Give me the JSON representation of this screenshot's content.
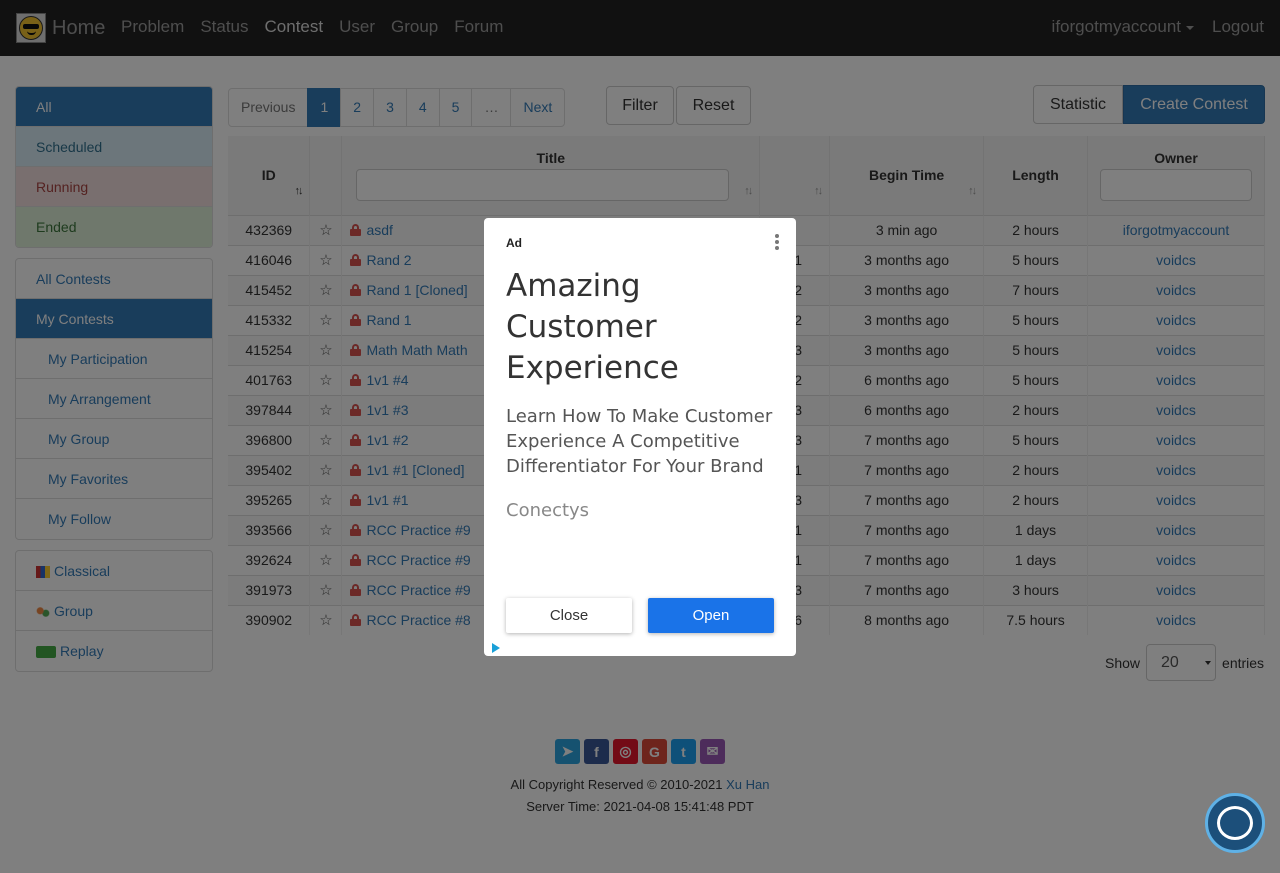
{
  "navbar": {
    "brand": "Home",
    "links": [
      "Problem",
      "Status",
      "Contest",
      "User",
      "Group",
      "Forum"
    ],
    "user": "iforgotmyaccount",
    "logout": "Logout"
  },
  "sidebar": {
    "status_filters": [
      "All",
      "Scheduled",
      "Running",
      "Ended"
    ],
    "contest_scope": [
      "All Contests",
      "My Contests"
    ],
    "my_items": [
      "My Participation",
      "My Arrangement",
      "My Group",
      "My Favorites",
      "My Follow"
    ],
    "categories": [
      "Classical",
      "Group",
      "Replay"
    ]
  },
  "pagination": [
    "Previous",
    "1",
    "2",
    "3",
    "4",
    "5",
    "…",
    "Next"
  ],
  "buttons": {
    "filter": "Filter",
    "reset": "Reset",
    "statistic": "Statistic",
    "create": "Create Contest"
  },
  "table": {
    "headers": {
      "id": "ID",
      "title": "Title",
      "begin": "Begin Time",
      "length": "Length",
      "owner": "Owner"
    },
    "rows": [
      {
        "id": "432369",
        "title": "asdf",
        "type": "",
        "begin": "3 min ago",
        "length": "2 hours",
        "owner": "iforgotmyaccount"
      },
      {
        "id": "416046",
        "title": "Rand 2",
        "type": "x1",
        "begin": "3 months ago",
        "length": "5 hours",
        "owner": "voidcs"
      },
      {
        "id": "415452",
        "title": "Rand 1 [Cloned]",
        "type": "x2",
        "begin": "3 months ago",
        "length": "7 hours",
        "owner": "voidcs"
      },
      {
        "id": "415332",
        "title": "Rand 1",
        "type": "x2",
        "begin": "3 months ago",
        "length": "5 hours",
        "owner": "voidcs"
      },
      {
        "id": "415254",
        "title": "Math Math Math",
        "type": "x3",
        "begin": "3 months ago",
        "length": "5 hours",
        "owner": "voidcs"
      },
      {
        "id": "401763",
        "title": "1v1 #4",
        "type": "x2",
        "begin": "6 months ago",
        "length": "5 hours",
        "owner": "voidcs"
      },
      {
        "id": "397844",
        "title": "1v1 #3",
        "type": "x3",
        "begin": "6 months ago",
        "length": "2 hours",
        "owner": "voidcs"
      },
      {
        "id": "396800",
        "title": "1v1 #2",
        "type": "x3",
        "begin": "7 months ago",
        "length": "5 hours",
        "owner": "voidcs"
      },
      {
        "id": "395402",
        "title": "1v1 #1 [Cloned]",
        "type": "x1",
        "begin": "7 months ago",
        "length": "2 hours",
        "owner": "voidcs"
      },
      {
        "id": "395265",
        "title": "1v1 #1",
        "type": "x3",
        "begin": "7 months ago",
        "length": "2 hours",
        "owner": "voidcs"
      },
      {
        "id": "393566",
        "title": "RCC Practice #9",
        "type": "x1",
        "begin": "7 months ago",
        "length": "1 days",
        "owner": "voidcs"
      },
      {
        "id": "392624",
        "title": "RCC Practice #9",
        "type": "x1",
        "begin": "7 months ago",
        "length": "1 days",
        "owner": "voidcs"
      },
      {
        "id": "391973",
        "title": "RCC Practice #9",
        "type": "x3",
        "begin": "7 months ago",
        "length": "3 hours",
        "owner": "voidcs"
      },
      {
        "id": "390902",
        "title": "RCC Practice #8",
        "type": "x6",
        "begin": "8 months ago",
        "length": "7.5 hours",
        "owner": "voidcs"
      }
    ]
  },
  "entries": {
    "show": "Show",
    "value": "20",
    "suffix": "entries"
  },
  "footer": {
    "copyright": "All Copyright Reserved © 2010-2021",
    "author": "Xu Han",
    "server_time": "Server Time: 2021-04-08 15:41:48 PDT"
  },
  "ad": {
    "label": "Ad",
    "headline": "Amazing Customer Experience",
    "body": "Learn How To Make Customer Experience A Competitive Differentiator For Your Brand",
    "advertiser": "Conectys",
    "close": "Close",
    "open": "Open"
  },
  "colors": {
    "primary": "#337ab7",
    "navbar": "#222222",
    "danger": "#d9534f",
    "success": "#3c763d",
    "ad_open": "#1a73e8"
  }
}
